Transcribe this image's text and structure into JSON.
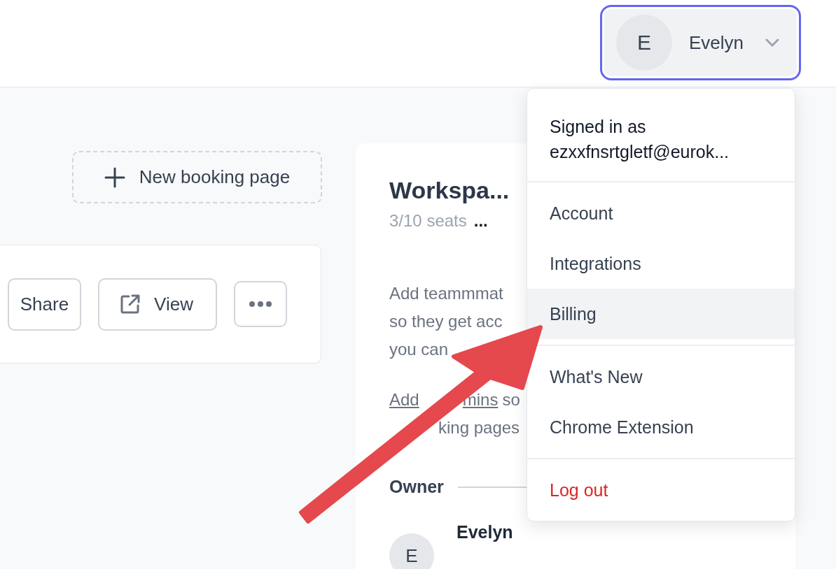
{
  "header": {
    "user_menu": {
      "initial": "E",
      "name": "Evelyn",
      "open": true
    }
  },
  "new_booking_button": {
    "label": "New booking page"
  },
  "booking_card": {
    "buttons": [
      {
        "kind": "share",
        "label": "Share"
      },
      {
        "kind": "view",
        "label": "View"
      },
      {
        "kind": "more"
      }
    ]
  },
  "workspace_card": {
    "title": "Workspa...",
    "seats": "3/10 seats",
    "seats_more": "...",
    "description_lines": [
      "Add teammmat",
      "so they get acc",
      "you can"
    ],
    "admins_link_parts": [
      "Add",
      "mins"
    ],
    "admins_rest": "so",
    "admins_line_2": "king pages",
    "owner_label": "Owner",
    "owner": {
      "initial": "E",
      "name": "Evelyn"
    }
  },
  "dropdown": {
    "signed_in_label": "Signed in as",
    "email": "ezxxfnsrtgletf@eurok...",
    "sections": [
      [
        {
          "label": "Account",
          "selected": false,
          "kind": "normal"
        },
        {
          "label": "Integrations",
          "selected": false,
          "kind": "normal"
        },
        {
          "label": "Billing",
          "selected": true,
          "kind": "normal"
        }
      ],
      [
        {
          "label": "What's New",
          "selected": false,
          "kind": "normal"
        },
        {
          "label": "Chrome Extension",
          "selected": false,
          "kind": "normal"
        }
      ],
      [
        {
          "label": "Log out",
          "selected": false,
          "kind": "danger"
        }
      ]
    ]
  }
}
